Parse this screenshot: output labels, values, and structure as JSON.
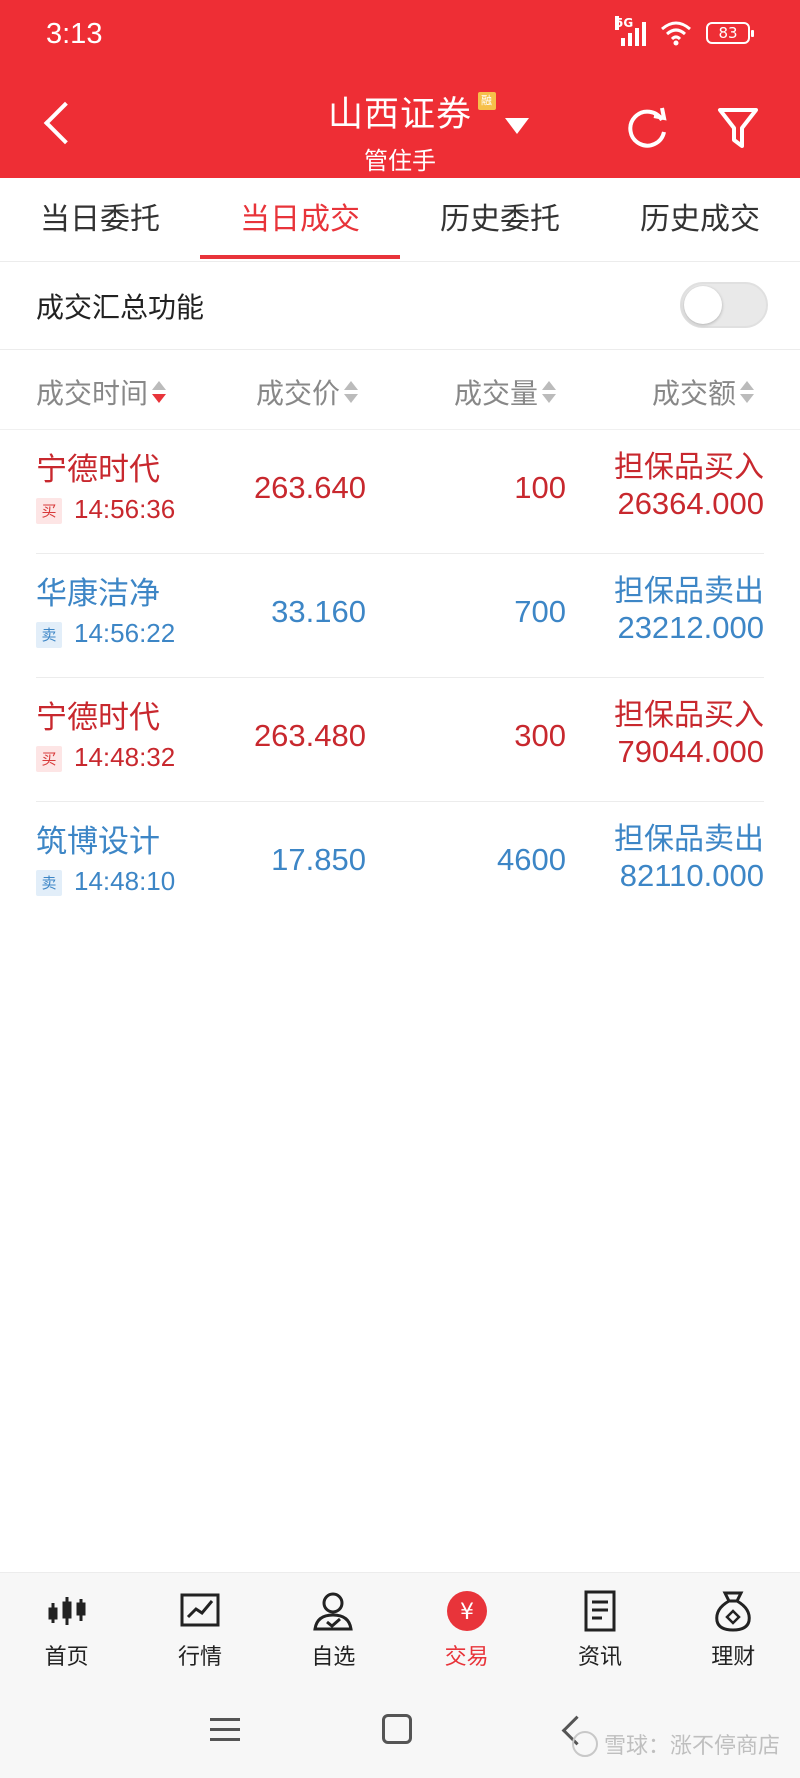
{
  "status_bar": {
    "time": "3:13",
    "network": "5G",
    "battery": "83"
  },
  "header": {
    "title": "山西证券",
    "badge": "融",
    "subtitle": "管住手"
  },
  "tabs": [
    {
      "label": "当日委托",
      "active": false
    },
    {
      "label": "当日成交",
      "active": true
    },
    {
      "label": "历史委托",
      "active": false
    },
    {
      "label": "历史成交",
      "active": false
    }
  ],
  "summary": {
    "label": "成交汇总功能",
    "enabled": false
  },
  "columns": {
    "time": "成交时间",
    "price": "成交价",
    "qty": "成交量",
    "amount": "成交额"
  },
  "trades": [
    {
      "name": "宁德时代",
      "side": "买",
      "time": "14:56:36",
      "price": "263.640",
      "qty": "100",
      "direction": "担保品买入",
      "amount": "26364.000",
      "color": "#c8282e"
    },
    {
      "name": "华康洁净",
      "side": "卖",
      "time": "14:56:22",
      "price": "33.160",
      "qty": "700",
      "direction": "担保品卖出",
      "amount": "23212.000",
      "color": "#3d86c6"
    },
    {
      "name": "宁德时代",
      "side": "买",
      "time": "14:48:32",
      "price": "263.480",
      "qty": "300",
      "direction": "担保品买入",
      "amount": "79044.000",
      "color": "#c8282e"
    },
    {
      "name": "筑博设计",
      "side": "卖",
      "time": "14:48:10",
      "price": "17.850",
      "qty": "4600",
      "direction": "担保品卖出",
      "amount": "82110.000",
      "color": "#3d86c6"
    }
  ],
  "bottom_nav": [
    {
      "label": "首页",
      "icon": "candlestick-icon"
    },
    {
      "label": "行情",
      "icon": "chart-icon"
    },
    {
      "label": "自选",
      "icon": "user-check-icon"
    },
    {
      "label": "交易",
      "icon": "yuan-icon",
      "glyph": "¥"
    },
    {
      "label": "资讯",
      "icon": "document-icon"
    },
    {
      "label": "理财",
      "icon": "moneybag-icon"
    }
  ],
  "watermark": "雪球：涨不停商店",
  "colors": {
    "brand": "#ee2e35",
    "buy": "#c8282e",
    "sell": "#3d86c6"
  }
}
